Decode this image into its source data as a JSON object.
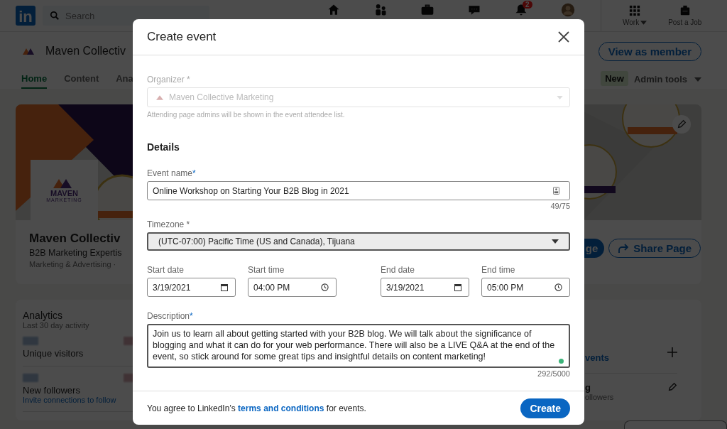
{
  "top_nav": {
    "logo": "in",
    "search": {
      "placeholder": "Search"
    },
    "notifications_badge": "2",
    "work_label": "Work",
    "post_job_label": "Post a Job"
  },
  "page_header": {
    "name": "Maven Collectiv",
    "view_as_member": "View as member",
    "new_badge": "New",
    "admin_tools": "Admin tools",
    "tabs": [
      {
        "label": "Home",
        "selected": true
      },
      {
        "label": "Content",
        "selected": false
      },
      {
        "label": "Ana",
        "selected": false
      }
    ]
  },
  "profile_card": {
    "logo_text": "MAVEN",
    "logo_subtext": "MARKETING",
    "name": "Maven Collectiv",
    "tagline": "B2B Marketing Expertis",
    "industry": "Marketing & Advertising ·",
    "primary_button": "ge",
    "share_button": "Share Page"
  },
  "analytics": {
    "title": "Analytics",
    "subtitle": "Last 30 day activity",
    "metrics": [
      {
        "label": "Unique visitors"
      },
      {
        "label": "New followers",
        "link": "Invite connections to follow"
      }
    ]
  },
  "right_card": {
    "link": "vents",
    "line_1": "g",
    "line_2": "ollowers"
  },
  "modal": {
    "title": "Create event",
    "organizer": {
      "label": "Organizer",
      "required_mark": "*",
      "value": "Maven Collective Marketing",
      "disabled": true,
      "hint": "Attending page admins will be shown in the event attendee list."
    },
    "section": "Details",
    "event_name": {
      "label": "Event name",
      "required_mark": "*",
      "value": "Online Workshop on Starting Your B2B Blog in 2021",
      "counter": "49/75"
    },
    "timezone": {
      "label": "Timezone",
      "required_mark": "*",
      "value": "(UTC-07:00) Pacific Time (US and Canada), Tijuana",
      "focused": true
    },
    "date_fields": [
      {
        "label": "Start date",
        "kind": "date",
        "value": "3/19/2021"
      },
      {
        "label": "Start time",
        "kind": "time",
        "value": "04:00 PM"
      },
      {
        "label": "End date",
        "kind": "date",
        "value": "3/19/2021"
      },
      {
        "label": "End time",
        "kind": "time",
        "value": "05:00 PM"
      }
    ],
    "description": {
      "label": "Description",
      "required_mark": "*",
      "value": "Join us to learn all about getting started with your B2B blog. We will talk about the significance of blogging and what it can do for your web performance. There will also be a LIVE Q&A at the end of the event, so stick around for some great tips and insightful details on content marketing!",
      "counter": "292/5000",
      "focused": true
    },
    "footer": {
      "text_before": "You agree to LinkedIn’s ",
      "link": "terms and conditions",
      "text_after": " for events."
    },
    "create_button": "Create"
  }
}
